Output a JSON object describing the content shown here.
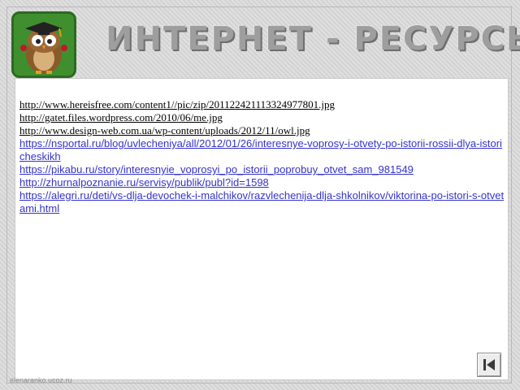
{
  "header": {
    "title": "ИНТЕРНЕТ - РЕСУРСЫ",
    "logo_icon": "owl-graduate-icon"
  },
  "links": [
    "http://www.hereisfree.com/content1//pic/zip/201122421113324977801.jpg",
    "http://gatet.files.wordpress.com/2010/06/me.jpg",
    "http://www.design-web.com.ua/wp-content/uploads/2012/11/owl.jpg",
    "https://nsportal.ru/blog/uvlecheniya/all/2012/01/26/interesnye-voprosy-i-otvety-po-istorii-rossii-dlya-istoricheskikh",
    "https://pikabu.ru/story/interesnyie_voprosyi_po_istorii_poprobuy_otvet_sam_981549",
    "http://zhurnalpoznanie.ru/servisy/publik/publ?id=1598",
    "https://alegri.ru/deti/vs-dlja-devochek-i-malchikov/razvlechenija-dlja-shkolnikov/viktorina-po-istori-s-otvetami.html"
  ],
  "footer": {
    "watermark": "elenaranko.ucoz.ru",
    "nav_icon": "return-to-start-icon"
  },
  "colors": {
    "background": "#d9d9d9",
    "title_text": "#9e9e9e",
    "link_blue": "#3333cc",
    "owl_box": "#3f8f2f"
  }
}
